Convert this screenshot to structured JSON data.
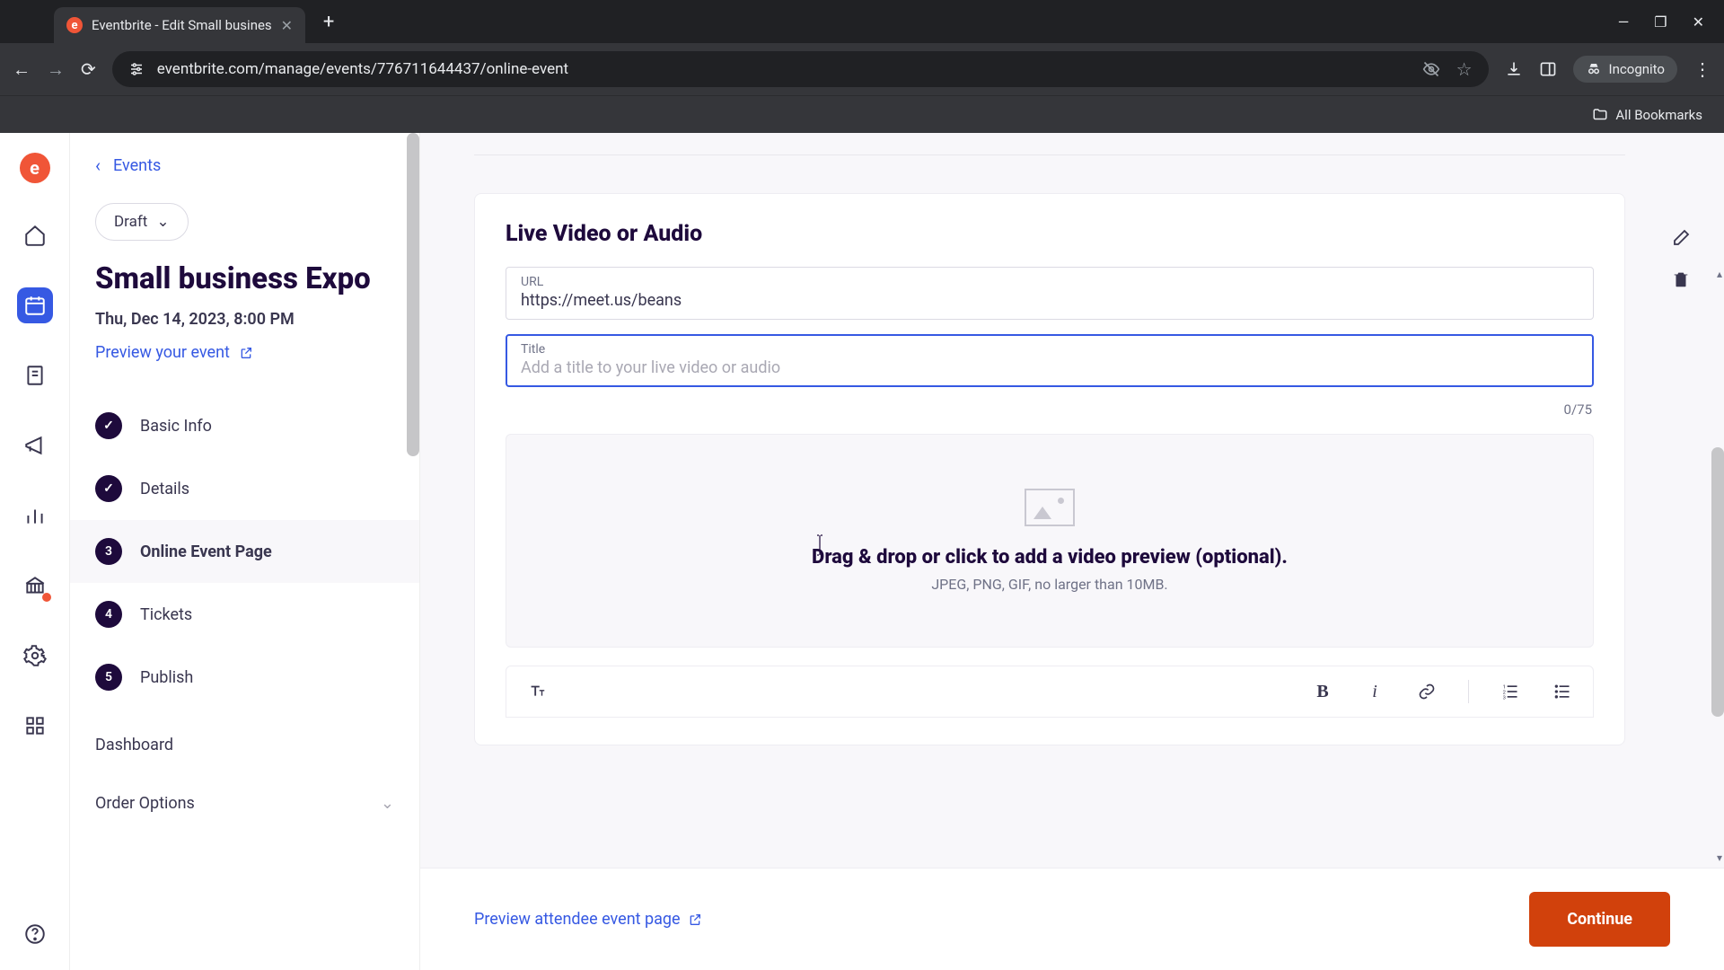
{
  "browser": {
    "tab_title": "Eventbrite - Edit Small busines",
    "tab_favicon_letter": "e",
    "url": "eventbrite.com/manage/events/776711644437/online-event",
    "incognito_label": "Incognito",
    "all_bookmarks": "All Bookmarks"
  },
  "brand_letter": "e",
  "sidebar": {
    "back_label": "Events",
    "status": "Draft",
    "event_title": "Small business Expo",
    "event_date": "Thu, Dec 14, 2023, 8:00 PM",
    "preview_label": "Preview your event",
    "steps": [
      {
        "badge": "done",
        "label": "Basic Info"
      },
      {
        "badge": "done",
        "label": "Details"
      },
      {
        "badge": "3",
        "label": "Online Event Page"
      },
      {
        "badge": "4",
        "label": "Tickets"
      },
      {
        "badge": "5",
        "label": "Publish"
      }
    ],
    "dashboard": "Dashboard",
    "order_options": "Order Options"
  },
  "main": {
    "section_title": "Live Video or Audio",
    "url_label": "URL",
    "url_value": "https://meet.us/beans",
    "title_label": "Title",
    "title_placeholder": "Add a title to your live video or audio",
    "title_value": "",
    "char_count": "0/75",
    "dropzone_title": "Drag & drop or click to add a video preview (optional).",
    "dropzone_sub": "JPEG, PNG, GIF, no larger than 10MB."
  },
  "footer": {
    "preview_link": "Preview attendee event page",
    "continue": "Continue"
  }
}
